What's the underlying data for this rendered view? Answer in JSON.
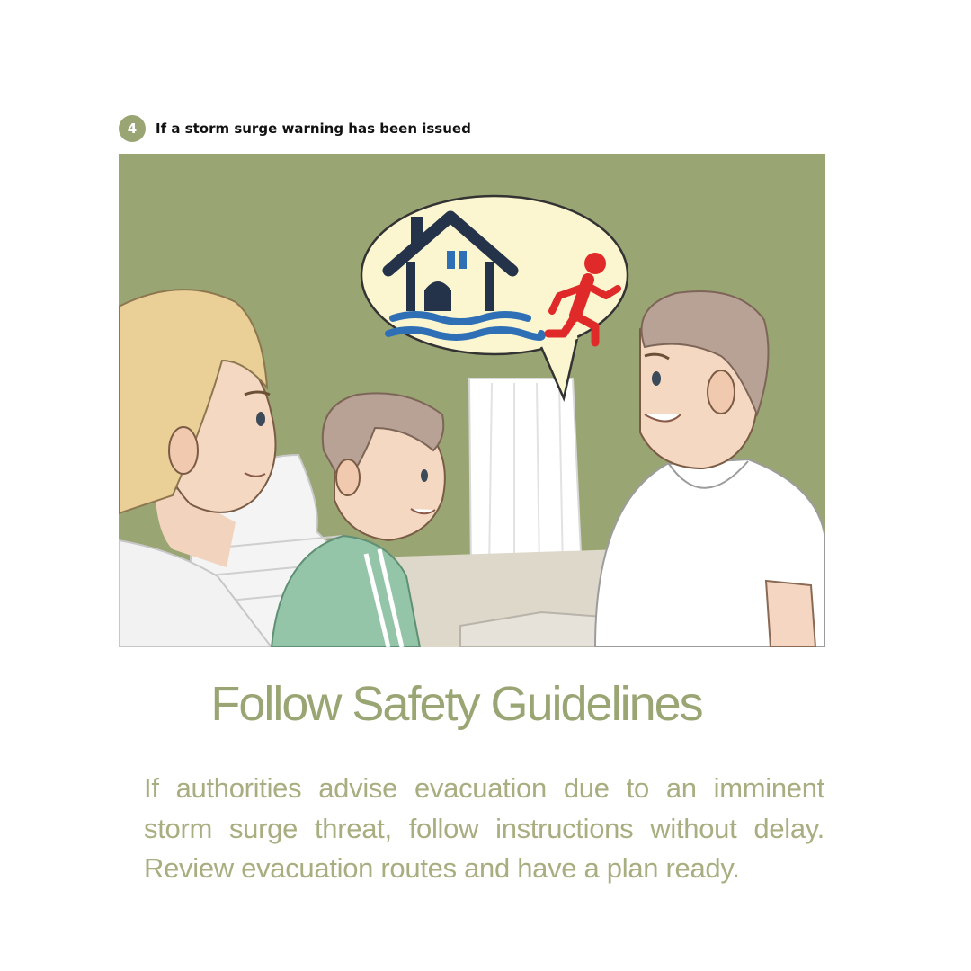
{
  "step": {
    "number": "4",
    "title": "If a storm surge warning has been issued"
  },
  "heading": "Follow Safety Guidelines",
  "body": "If authorities advise evacuation due to an imminent storm surge threat, follow instructions without delay. Review evacuation routes and have a plan ready.",
  "colors": {
    "accent": "#9aa574",
    "body_text": "#a8ae80",
    "illustration_background": "#9aa574",
    "house": "#24334a",
    "water": "#2f6fb5",
    "running_figure": "#e02a2a",
    "speech_bubble": "#fbf6cf"
  },
  "illustration": {
    "icons": [
      "speech-bubble-icon",
      "house-icon",
      "flood-water-icon",
      "running-person-icon"
    ]
  }
}
